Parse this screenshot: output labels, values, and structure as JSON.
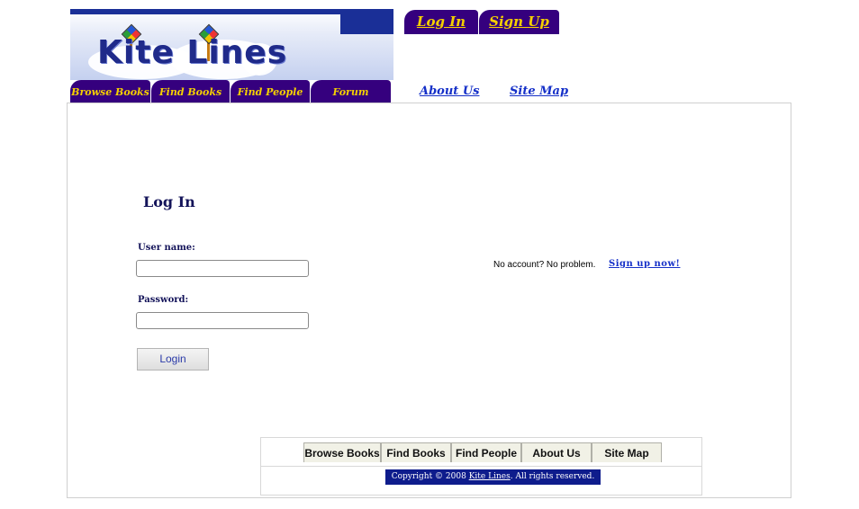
{
  "header": {
    "logo_text": "Kite Lines",
    "top_tabs": [
      {
        "label": "Log In"
      },
      {
        "label": "Sign Up"
      }
    ],
    "nav_tabs": [
      {
        "label": "Browse Books"
      },
      {
        "label": "Find Books"
      },
      {
        "label": "Find People"
      },
      {
        "label": "Forum"
      }
    ],
    "nav_links": [
      {
        "label": "About Us"
      },
      {
        "label": "Site Map"
      }
    ]
  },
  "login": {
    "title": "Log In",
    "username_label": "User name:",
    "username_value": "",
    "password_label": "Password:",
    "password_value": "",
    "button_label": "Login"
  },
  "signup_prompt": {
    "text": "No account? No problem.",
    "link": "Sign up now!"
  },
  "footer": {
    "tabs": [
      {
        "label": "Browse Books"
      },
      {
        "label": "Find Books"
      },
      {
        "label": "Find People"
      },
      {
        "label": "About Us"
      },
      {
        "label": "Site Map"
      }
    ],
    "copyright_prefix": "Copyright © 2008",
    "copyright_link": "Kite Lines",
    "copyright_suffix": ". All rights reserved."
  },
  "colors": {
    "tab_bg": "#35007e",
    "tab_text": "#f5d000",
    "link": "#1530c8",
    "copyright_bg": "#0e1c8c"
  }
}
